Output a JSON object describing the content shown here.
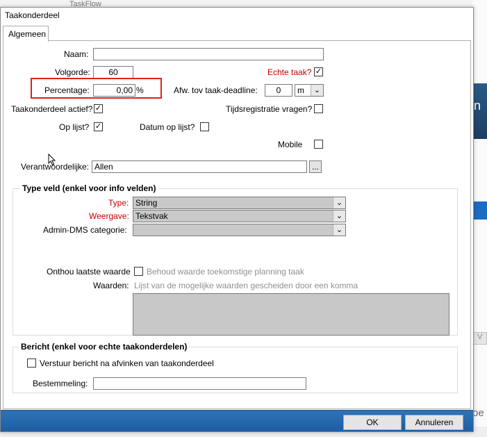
{
  "background": {
    "window_title": "TaskFlow",
    "right_fragment_text": "n",
    "right_button_text": "V",
    "right_bottom_text": "oe"
  },
  "dialog": {
    "title": "Taakonderdeel",
    "tab_label": "Algemeen",
    "fields": {
      "naam_label": "Naam:",
      "naam_value": "",
      "volgorde_label": "Volgorde:",
      "volgorde_value": "60",
      "echte_taak_label": "Echte taak?",
      "echte_taak_checked": "✓",
      "percentage_label": "Percentage:",
      "percentage_value": "0,00",
      "percentage_unit": "%",
      "afw_label": "Afw. tov taak-deadline:",
      "afw_value": "0",
      "afw_unit": "m",
      "actief_label": "Taakonderdeel actief?",
      "actief_checked": "✓",
      "tijdsreg_label": "Tijdsregistratie vragen?",
      "tijdsreg_checked": "",
      "oplijst_label": "Op lijst?",
      "oplijst_checked": "✓",
      "datum_label": "Datum op lijst?",
      "datum_checked": "",
      "mobile_label": "Mobile",
      "mobile_checked": "",
      "verantw_label": "Verantwoordelijke:",
      "verantw_value": "Allen",
      "browse_label": "..."
    },
    "type_group": {
      "title": "Type veld (enkel voor info velden)",
      "type_label": "Type:",
      "type_value": "String",
      "weergave_label": "Weergave:",
      "weergave_value": "Tekstvak",
      "admin_label": "Admin-DMS categorie:",
      "admin_value": "",
      "onthou_label": "Onthou laatste waarde",
      "onthou_checked": "",
      "behoud_label": "Behoud waarde toekomstige planning taak",
      "waarden_label": "Waarden:",
      "waarden_hint": "Lijst van de mogelijke waarden gescheiden door een komma"
    },
    "bericht_group": {
      "title": "Bericht (enkel voor echte taakonderdelen)",
      "verstuur_label": "Verstuur bericht na afvinken van taakonderdeel",
      "verstuur_checked": "",
      "bestemmeling_label": "Bestemmeling:",
      "bestemmeling_value": ""
    },
    "buttons": {
      "ok": "OK",
      "cancel": "Annuleren"
    }
  },
  "colors": {
    "footer_blue": "#1c5ea3",
    "required_label_red": "#c00000",
    "highlight_red": "#e01e1e"
  }
}
